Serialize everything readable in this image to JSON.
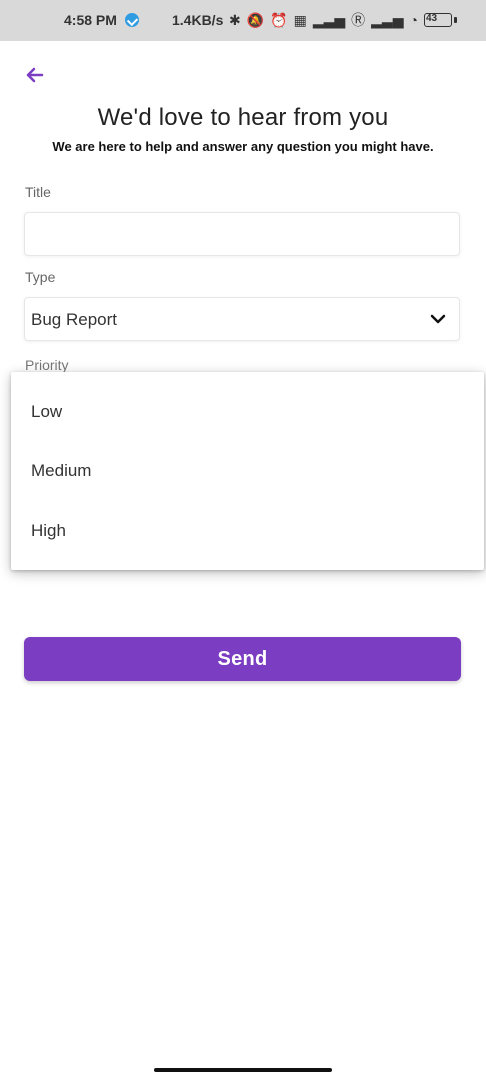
{
  "status_bar": {
    "time": "4:58 PM",
    "net_speed": "1.4KB/s",
    "battery_level": "43"
  },
  "header": {
    "back_icon": "arrow-left-icon",
    "title": "We'd love to hear from you",
    "subtitle": "We are here to help and answer any question you might have."
  },
  "form": {
    "title_label": "Title",
    "title_value": "",
    "type_label": "Type",
    "type_value": "Bug Report",
    "priority_label": "Priority",
    "priority_options": [
      "Low",
      "Medium",
      "High"
    ]
  },
  "actions": {
    "send_label": "Send"
  },
  "colors": {
    "accent": "#7b3dc1",
    "status_bar_bg": "#d9d9d9"
  }
}
